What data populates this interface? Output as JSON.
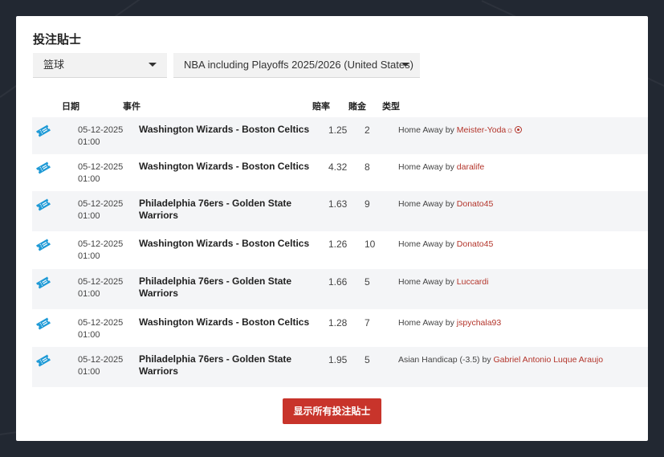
{
  "panel": {
    "title": "投注貼士"
  },
  "filters": {
    "sport": "篮球",
    "league": "NBA including Playoffs 2025/2026 (United States)"
  },
  "table": {
    "headers": {
      "date": "日期",
      "event": "事件",
      "odds": "賠率",
      "stake": "賭金",
      "type": "类型"
    },
    "rows": [
      {
        "date": "05-12-2025",
        "time": "01:00",
        "event": "Washington Wizards - Boston Celtics",
        "odds": "1.25",
        "stake": "2",
        "tip": "Home Away",
        "by": "by",
        "user": "Meister-Yoda",
        "badge": "☼"
      },
      {
        "date": "05-12-2025",
        "time": "01:00",
        "event": "Washington Wizards - Boston Celtics",
        "odds": "4.32",
        "stake": "8",
        "tip": "Home Away",
        "by": "by",
        "user": "daralife"
      },
      {
        "date": "05-12-2025",
        "time": "01:00",
        "event": "Philadelphia 76ers - Golden State Warriors",
        "odds": "1.63",
        "stake": "9",
        "tip": "Home Away",
        "by": "by",
        "user": "Donato45"
      },
      {
        "date": "05-12-2025",
        "time": "01:00",
        "event": "Washington Wizards - Boston Celtics",
        "odds": "1.26",
        "stake": "10",
        "tip": "Home Away",
        "by": "by",
        "user": "Donato45"
      },
      {
        "date": "05-12-2025",
        "time": "01:00",
        "event": "Philadelphia 76ers - Golden State Warriors",
        "odds": "1.66",
        "stake": "5",
        "tip": "Home Away",
        "by": "by",
        "user": "Luccardi"
      },
      {
        "date": "05-12-2025",
        "time": "01:00",
        "event": "Washington Wizards - Boston Celtics",
        "odds": "1.28",
        "stake": "7",
        "tip": "Home Away",
        "by": "by",
        "user": "jspychala93"
      },
      {
        "date": "05-12-2025",
        "time": "01:00",
        "event": "Philadelphia 76ers - Golden State Warriors",
        "odds": "1.95",
        "stake": "5",
        "tip": "Asian Handicap (-3.5)",
        "by": "by",
        "user": "Gabriel Antonio Luque Araujo"
      }
    ]
  },
  "footer": {
    "show_all_label": "显示所有投注貼士"
  },
  "colors": {
    "accent": "#c8342b",
    "ticket_icon": "#1f9ad6",
    "user_link": "#b3342a"
  },
  "icons": {
    "row": "ticket-icon",
    "select": "chevron-down-icon"
  }
}
